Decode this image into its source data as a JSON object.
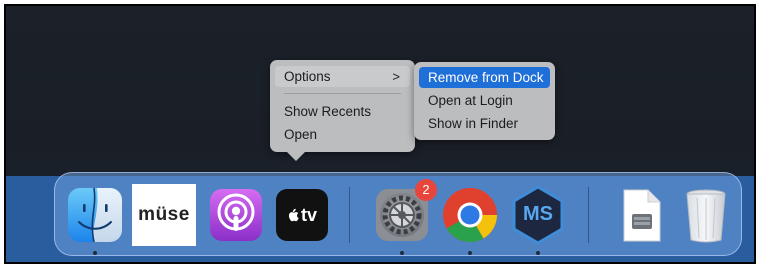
{
  "context_menu": {
    "items": [
      {
        "label": "Options",
        "submenu_arrow": ">"
      },
      {
        "label": "Show Recents"
      },
      {
        "label": "Open"
      }
    ],
    "submenu": {
      "items": [
        {
          "label": "Remove from Dock",
          "active": true
        },
        {
          "label": "Open at Login"
        },
        {
          "label": "Show in Finder"
        }
      ]
    }
  },
  "dock": {
    "apps": [
      {
        "icon": "finder-icon",
        "running": true
      },
      {
        "icon": "muse-icon",
        "label": "müse",
        "running": false
      },
      {
        "icon": "podcasts-icon",
        "running": false
      },
      {
        "icon": "apple-tv-icon",
        "label": "tv",
        "running": false
      },
      {
        "icon": "system-settings-icon",
        "badge": "2",
        "running": true
      },
      {
        "icon": "chrome-icon",
        "running": true
      },
      {
        "icon": "ms-app-icon",
        "label": "MS",
        "running": true
      },
      {
        "icon": "document-icon",
        "running": false
      },
      {
        "icon": "trash-icon",
        "running": false
      }
    ]
  },
  "colors": {
    "menu_bg": "#bcbdbf",
    "menu_highlight": "#1f6fd8",
    "badge": "#e8453c",
    "dock_band": "#2a5d9e"
  }
}
